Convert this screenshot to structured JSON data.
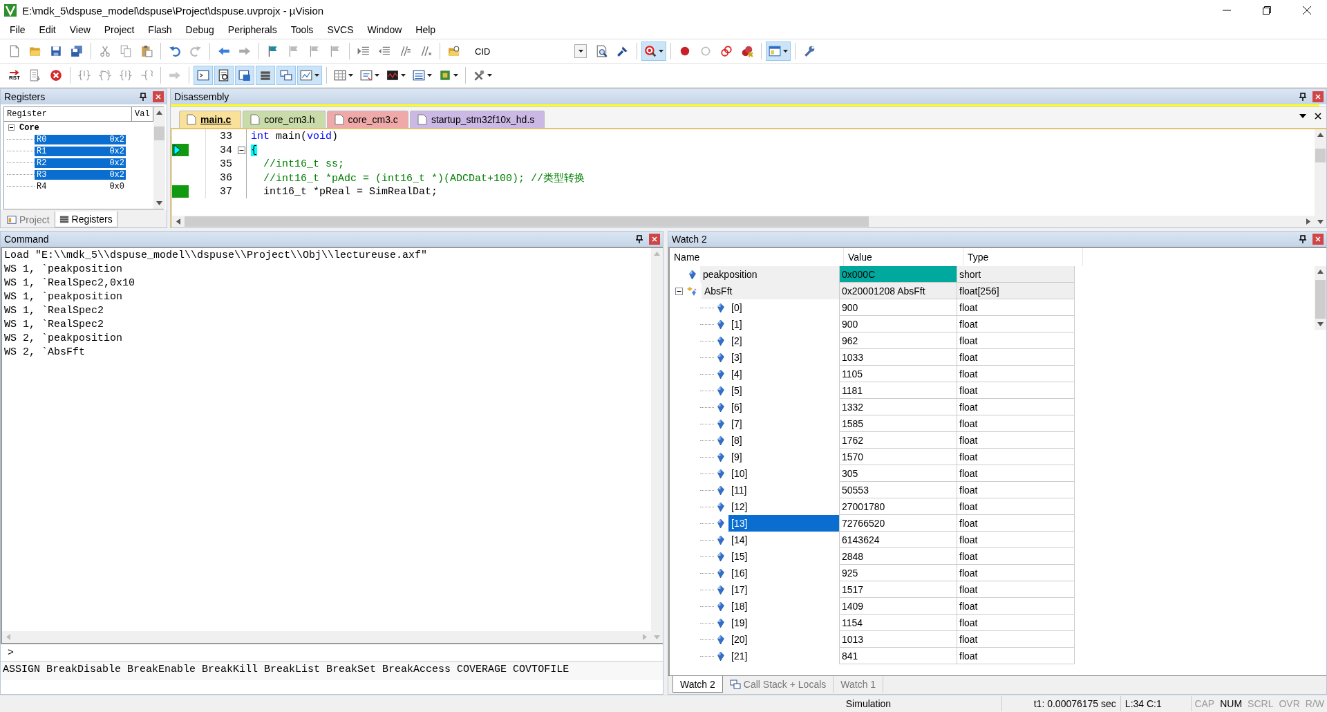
{
  "window": {
    "title": "E:\\mdk_5\\dspuse_model\\dspuse\\Project\\dspuse.uvprojx - µVision"
  },
  "menu": [
    "File",
    "Edit",
    "View",
    "Project",
    "Flash",
    "Debug",
    "Peripherals",
    "Tools",
    "SVCS",
    "Window",
    "Help"
  ],
  "toolbar": {
    "target": "CID",
    "buttons": [
      {
        "selected": false
      },
      {
        "selected": false
      },
      {
        "selected": false
      },
      {
        "selected": false
      },
      {
        "selected": false
      },
      {
        "selected": false
      },
      {
        "selected": false
      },
      {
        "selected": false
      },
      {
        "selected": false
      },
      {
        "selected": false
      },
      {
        "selected": false
      },
      {
        "selected": false
      },
      {
        "selected": false
      },
      {
        "selected": false
      },
      {
        "selected": false
      },
      {
        "selected": false
      },
      {
        "selected": false
      },
      {
        "selected": false
      },
      {
        "selected": false
      },
      {
        "selected": false
      },
      {
        "selected": false
      },
      {
        "selected": false
      },
      {
        "selected": true
      },
      {
        "selected": false
      },
      {
        "selected": false
      },
      {
        "selected": false
      },
      {
        "selected": false
      },
      {
        "selected": true
      },
      {
        "selected": false
      }
    ]
  },
  "debug_toolbar": {
    "reset_label": "RST",
    "buttons": [
      {
        "selected": false
      },
      {
        "selected": false
      },
      {
        "selected": false
      },
      {
        "selected": false
      },
      {
        "selected": false
      },
      {
        "selected": false
      },
      {
        "selected": false
      },
      {
        "selected": false
      },
      {
        "selected": true
      },
      {
        "selected": true
      },
      {
        "selected": true
      },
      {
        "selected": true
      },
      {
        "selected": true
      },
      {
        "selected": true
      },
      {
        "selected": false
      },
      {
        "selected": false
      },
      {
        "selected": false
      },
      {
        "selected": false
      },
      {
        "selected": false
      },
      {
        "selected": false
      }
    ]
  },
  "registers": {
    "title": "Registers",
    "columns": [
      "Register",
      "Val"
    ],
    "tree": [
      {
        "name": "Core",
        "selected": false,
        "expanded": true,
        "children": [
          {
            "name": "R0",
            "value": "0x2",
            "selected": true
          },
          {
            "name": "R1",
            "value": "0x2",
            "selected": true
          },
          {
            "name": "R2",
            "value": "0x2",
            "selected": true
          },
          {
            "name": "R3",
            "value": "0x2",
            "selected": true
          },
          {
            "name": "R4",
            "value": "0x0",
            "selected": false
          }
        ]
      }
    ],
    "tabs": [
      {
        "label": "Project",
        "selected": false
      },
      {
        "label": "Registers",
        "selected": true
      }
    ]
  },
  "disassembly": {
    "title": "Disassembly",
    "tabs": [
      {
        "label": "main.c",
        "selected": true,
        "color": "#f9e19a"
      },
      {
        "label": "core_cm3.h",
        "selected": false,
        "color": "#c8dba8"
      },
      {
        "label": "core_cm3.c",
        "selected": false,
        "color": "#efa9a9"
      },
      {
        "label": "startup_stm32f10x_hd.s",
        "selected": false,
        "color": "#cbb8e4"
      }
    ],
    "lines": [
      {
        "number": "33",
        "current": false,
        "executed": false,
        "fold": false,
        "segments": [
          {
            "kind": "keyword",
            "text": "int"
          },
          {
            "kind": "plain",
            "text": " main("
          },
          {
            "kind": "keyword",
            "text": "void"
          },
          {
            "kind": "plain",
            "text": ")"
          }
        ]
      },
      {
        "number": "34",
        "current": true,
        "executed": true,
        "fold": true,
        "segments": [
          {
            "kind": "brace",
            "text": "{"
          }
        ]
      },
      {
        "number": "35",
        "current": false,
        "executed": false,
        "fold": false,
        "segments": [
          {
            "kind": "comment",
            "text": "  //int16_t ss;"
          }
        ]
      },
      {
        "number": "36",
        "current": false,
        "executed": false,
        "fold": false,
        "segments": [
          {
            "kind": "comment",
            "text": "  //int16_t *pAdc = (int16_t *)(ADCDat+100); //类型转换"
          }
        ]
      },
      {
        "number": "37",
        "current": false,
        "executed": true,
        "fold": false,
        "segments": [
          {
            "kind": "plain",
            "text": "  int16_t *pReal = SimRealDat;"
          }
        ]
      }
    ]
  },
  "command": {
    "title": "Command",
    "lines": [
      "Load \"E:\\\\mdk_5\\\\dspuse_model\\\\dspuse\\\\Project\\\\Obj\\\\lectureuse.axf\"",
      "WS 1, `peakposition",
      "WS 1, `RealSpec2,0x10",
      "WS 1, `peakposition",
      "WS 1, `RealSpec2",
      "WS 1, `RealSpec2",
      "WS 2, `peakposition",
      "WS 2, `AbsFft"
    ],
    "prompt": ">",
    "hints": "ASSIGN BreakDisable BreakEnable BreakKill BreakList BreakSet BreakAccess COVERAGE COVTOFILE"
  },
  "watch": {
    "title": "Watch 2",
    "columns": [
      "Name",
      "Value",
      "Type"
    ],
    "rows": [
      {
        "kind": "variable",
        "name": "peakposition",
        "value": "0x000C",
        "type": "short",
        "changed": true,
        "selected": false
      },
      {
        "kind": "array",
        "name": "AbsFft",
        "value": "0x20001208 AbsFft",
        "type": "float[256]",
        "changed": false,
        "selected": false,
        "expanded": true,
        "children": [
          {
            "kind": "variable",
            "name": "[0]",
            "value": "900",
            "type": "float",
            "changed": false,
            "selected": false
          },
          {
            "kind": "variable",
            "name": "[1]",
            "value": "900",
            "type": "float",
            "changed": false,
            "selected": false
          },
          {
            "kind": "variable",
            "name": "[2]",
            "value": "962",
            "type": "float",
            "changed": false,
            "selected": false
          },
          {
            "kind": "variable",
            "name": "[3]",
            "value": "1033",
            "type": "float",
            "changed": false,
            "selected": false
          },
          {
            "kind": "variable",
            "name": "[4]",
            "value": "1105",
            "type": "float",
            "changed": false,
            "selected": false
          },
          {
            "kind": "variable",
            "name": "[5]",
            "value": "1181",
            "type": "float",
            "changed": false,
            "selected": false
          },
          {
            "kind": "variable",
            "name": "[6]",
            "value": "1332",
            "type": "float",
            "changed": false,
            "selected": false
          },
          {
            "kind": "variable",
            "name": "[7]",
            "value": "1585",
            "type": "float",
            "changed": false,
            "selected": false
          },
          {
            "kind": "variable",
            "name": "[8]",
            "value": "1762",
            "type": "float",
            "changed": false,
            "selected": false
          },
          {
            "kind": "variable",
            "name": "[9]",
            "value": "1570",
            "type": "float",
            "changed": false,
            "selected": false
          },
          {
            "kind": "variable",
            "name": "[10]",
            "value": "305",
            "type": "float",
            "changed": false,
            "selected": false
          },
          {
            "kind": "variable",
            "name": "[11]",
            "value": "50553",
            "type": "float",
            "changed": false,
            "selected": false
          },
          {
            "kind": "variable",
            "name": "[12]",
            "value": "27001780",
            "type": "float",
            "changed": false,
            "selected": false
          },
          {
            "kind": "variable",
            "name": "[13]",
            "value": "72766520",
            "type": "float",
            "changed": false,
            "selected": true
          },
          {
            "kind": "variable",
            "name": "[14]",
            "value": "6143624",
            "type": "float",
            "changed": false,
            "selected": false
          },
          {
            "kind": "variable",
            "name": "[15]",
            "value": "2848",
            "type": "float",
            "changed": false,
            "selected": false
          },
          {
            "kind": "variable",
            "name": "[16]",
            "value": "925",
            "type": "float",
            "changed": false,
            "selected": false
          },
          {
            "kind": "variable",
            "name": "[17]",
            "value": "1517",
            "type": "float",
            "changed": false,
            "selected": false
          },
          {
            "kind": "variable",
            "name": "[18]",
            "value": "1409",
            "type": "float",
            "changed": false,
            "selected": false
          },
          {
            "kind": "variable",
            "name": "[19]",
            "value": "1154",
            "type": "float",
            "changed": false,
            "selected": false
          },
          {
            "kind": "variable",
            "name": "[20]",
            "value": "1013",
            "type": "float",
            "changed": false,
            "selected": false
          },
          {
            "kind": "variable",
            "name": "[21]",
            "value": "841",
            "type": "float",
            "changed": false,
            "selected": false
          }
        ]
      }
    ],
    "tabs": [
      {
        "label": "Watch 2",
        "selected": true,
        "kind": "plain"
      },
      {
        "label": "Call Stack + Locals",
        "selected": false,
        "kind": "stack"
      },
      {
        "label": "Watch 1",
        "selected": false,
        "kind": "plain"
      }
    ]
  },
  "status_bar": {
    "mode": "Simulation",
    "time": "t1: 0.00076175 sec",
    "position": "L:34 C:1",
    "indicators": [
      {
        "label": "CAP",
        "on": false
      },
      {
        "label": "NUM",
        "on": true
      },
      {
        "label": "SCRL",
        "on": false
      },
      {
        "label": "OVR",
        "on": false
      },
      {
        "label": "R/W",
        "on": false
      }
    ]
  }
}
